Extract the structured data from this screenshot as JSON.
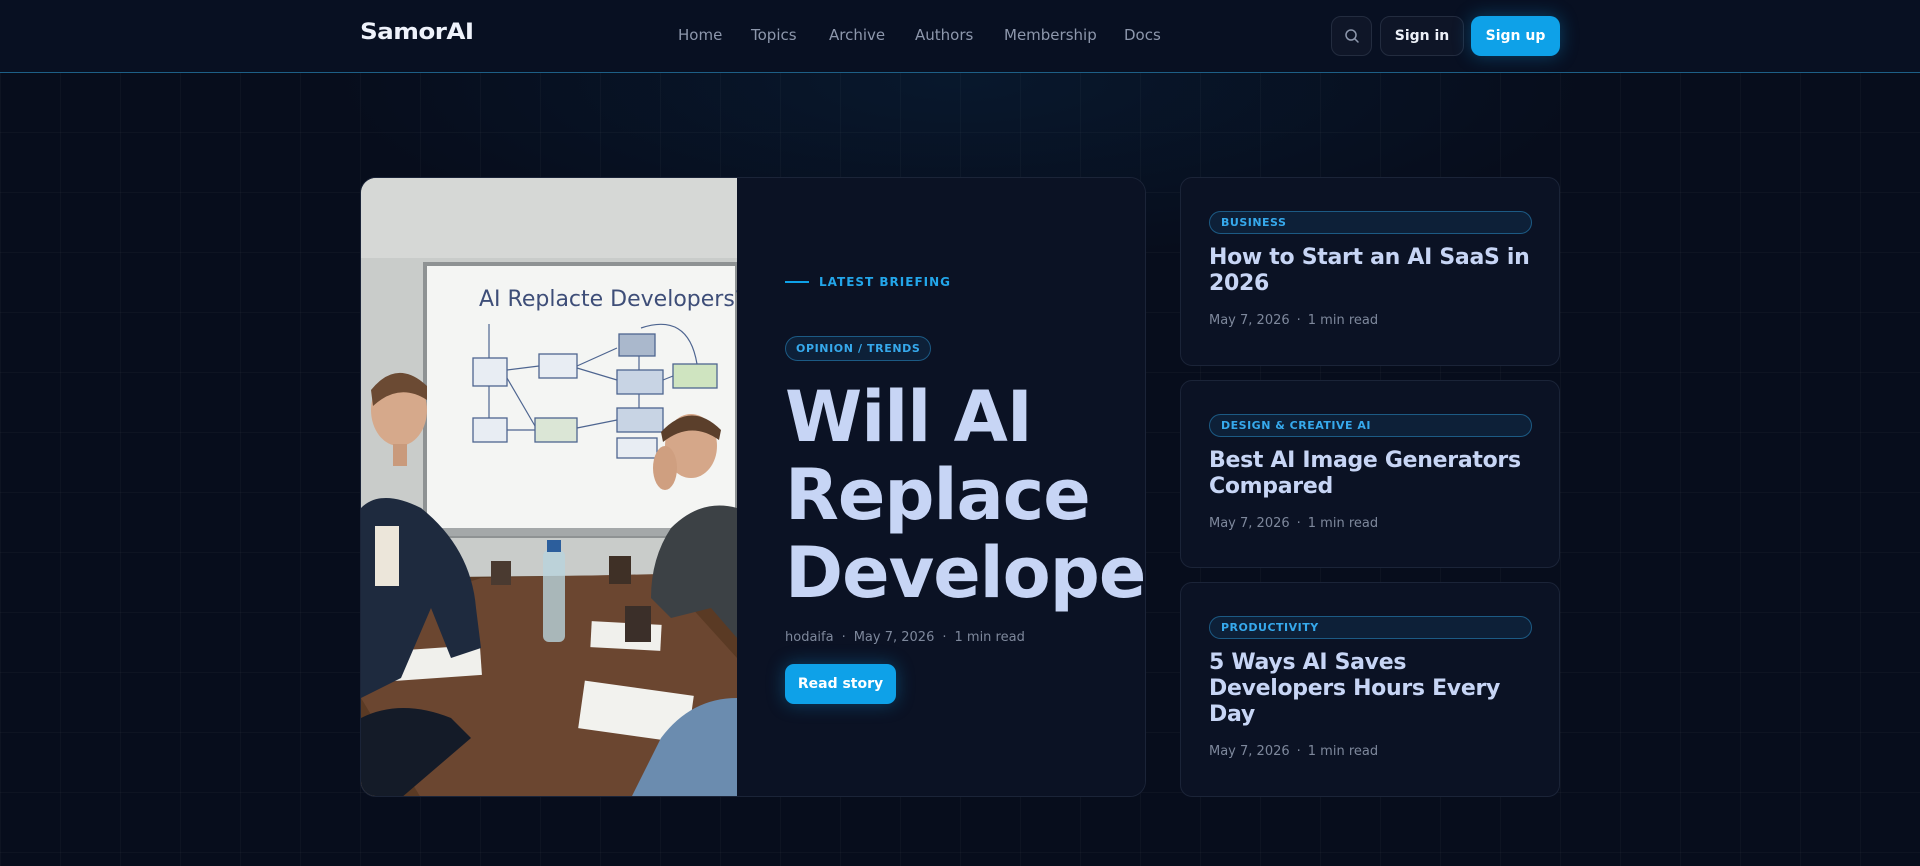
{
  "header": {
    "logo": "SamorAI",
    "nav": [
      "Home",
      "Topics",
      "Archive",
      "Authors",
      "Membership",
      "Docs"
    ],
    "search_icon": "search-icon",
    "signin_label": "Sign in",
    "signup_label": "Sign up"
  },
  "featured": {
    "image_caption": "AI Replacte Developers?",
    "eyebrow": "LATEST BRIEFING",
    "tag": "OPINION / TRENDS",
    "title": "Will AI\nReplace\nDevelopers?",
    "author": "hodaifa",
    "date": "May 7, 2026",
    "read_time": "1 min read",
    "cta": "Read story"
  },
  "side_articles": [
    {
      "category": "BUSINESS",
      "title": "How to Start an AI SaaS in 2026",
      "date": "May 7, 2026",
      "read_time": "1 min read"
    },
    {
      "category": "DESIGN & CREATIVE AI",
      "title": "Best AI Image Generators Compared",
      "date": "May 7, 2026",
      "read_time": "1 min read"
    },
    {
      "category": "PRODUCTIVITY",
      "title": "5 Ways AI Saves Developers Hours Every Day",
      "date": "May 7, 2026",
      "read_time": "1 min read"
    }
  ],
  "colors": {
    "accent": "#0ea1e8",
    "background": "#070d1c",
    "card": "#0b1224",
    "headline": "#c7d5f5"
  }
}
